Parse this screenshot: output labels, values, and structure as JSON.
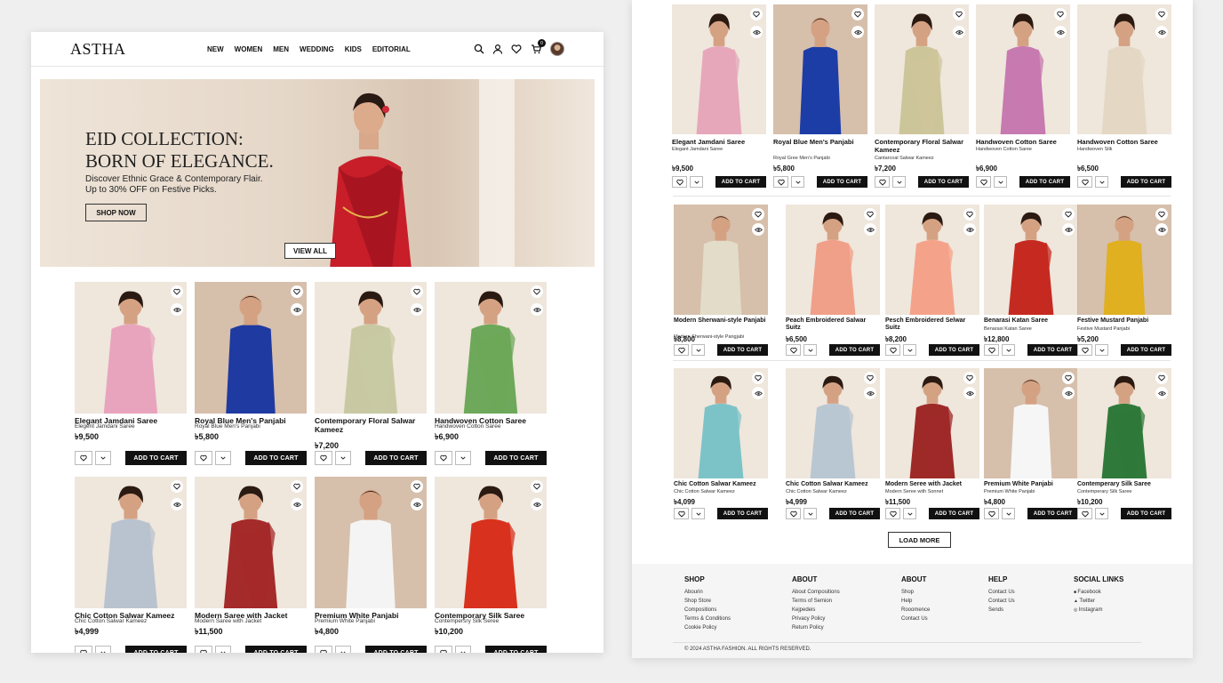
{
  "brand": "ASTHA",
  "nav": [
    "NEW",
    "WOMEN",
    "MEN",
    "WEDDING",
    "KIDS",
    "EDITORIAL"
  ],
  "cart_count": "0",
  "icons": {
    "search": "search-icon",
    "user": "user-icon",
    "wishlist": "heart-icon",
    "cart": "cart-icon",
    "quickview": "eye-icon",
    "dropdown": "chevron-down-icon"
  },
  "hero": {
    "title_line1": "EID COLLECTION:",
    "title_line2": "BORN OF ELEGANCE.",
    "subtitle_line1": "Discover Ethnic Grace & Contemporary Flair.",
    "subtitle_line2": "Up to 30% OFF on Festive Picks.",
    "shop_now": "SHOP NOW",
    "view_all": "VIEW ALL"
  },
  "add_to_cart": "ADD TO CART",
  "left_products": [
    {
      "name": "Elegant Jamdani Saree",
      "sub": "Elegent Jamdani Saree",
      "price": "৳9,500",
      "color": "#e8a4bd"
    },
    {
      "name": "Royal Blue Men's Panjabi",
      "sub": "Royal Blue Men's Panjabi",
      "price": "৳5,800",
      "color": "#1f3aa0"
    },
    {
      "name": "Contemporary Floral Salwar Kameez",
      "sub": "",
      "price": "৳7,200",
      "color": "#c8c9a3"
    },
    {
      "name": "Handwoven Cotton Saree",
      "sub": "Handwoven Cotton Saree",
      "price": "৳6,900",
      "color": "#6ea85a"
    },
    {
      "name": "Chic Cotton Salwar Kameez",
      "sub": "Chic Cotton Salwar Kameez",
      "price": "৳4,999",
      "color": "#b9c3cf"
    },
    {
      "name": "Modern Saree with Jacket",
      "sub": "Modern Saree with Jacket",
      "price": "৳11,500",
      "color": "#a52a2a"
    },
    {
      "name": "Premium White Panjabi",
      "sub": "Premium White Panjabi",
      "price": "৳4,800",
      "color": "#f4f4f4"
    },
    {
      "name": "Contemporary Silk Saree",
      "sub": "Contempersry Silk Seree",
      "price": "৳10,200",
      "color": "#d8321e"
    }
  ],
  "right_row1": [
    {
      "name": "Elegant Jamdani Saree",
      "sub": "Elegant Jamdani Saree",
      "price": "৳9,500",
      "color": "#e6a7bb"
    },
    {
      "name": "Royal Blue Men's Panjabi",
      "sub": "Royal Gree Men's Panjabi",
      "price": "৳5,800",
      "color": "#1d3da6"
    },
    {
      "name": "Contemporary Floral Salwar Kameez",
      "sub": "Cantarcoal Salwar Kameez",
      "price": "৳7,200",
      "color": "#cdc59a"
    },
    {
      "name": "Handwoven Cotton Saree",
      "sub": "Handwoven Cotton Saree",
      "price": "৳6,900",
      "color": "#c77ab0"
    },
    {
      "name": "Handwoven Cotton Saree",
      "sub": "Handwoven Silk",
      "price": "৳6,500",
      "color": "#e4d8c4"
    }
  ],
  "right_row2": [
    {
      "name": "Modern Sherwani-style Panjabi",
      "sub": "Modern Sherwani-style Pangjabi",
      "price": "৳8,800",
      "color": "#e3dcc8"
    },
    {
      "name": "Peach Embroidered Salwar Suitz",
      "sub": "",
      "price": "৳6,500",
      "color": "#f0a088"
    },
    {
      "name": "Pesch Embroidered Selwar Suitz",
      "sub": "",
      "price": "৳8,200",
      "color": "#f4a38a"
    },
    {
      "name": "Benarasi Katan Saree",
      "sub": "Benarasi Katan Saree",
      "price": "৳12,800",
      "color": "#c52a20"
    },
    {
      "name": "Festive Mustard Panjabi",
      "sub": "Festive Mustard Panjabi",
      "price": "৳5,200",
      "color": "#e0b020"
    }
  ],
  "right_row3": [
    {
      "name": "Chic Cotton Salwar Kameez",
      "sub": "Chic Cotton Salwar Kameez",
      "price": "৳4,099",
      "color": "#7cc3c8"
    },
    {
      "name": "Chic Cotton Salwar Kameez",
      "sub": "Chic Cotton Salwar Kameez",
      "price": "৳4,999",
      "color": "#b9c7d2"
    },
    {
      "name": "Modern Seree with Jacket",
      "sub": "Modern Seree with Sonnet",
      "price": "৳11,500",
      "color": "#9e2a28"
    },
    {
      "name": "Premium White Panjabi",
      "sub": "Premium White Panjabi",
      "price": "৳4,800",
      "color": "#f6f6f6"
    },
    {
      "name": "Contemperary Silk Saree",
      "sub": "Contemperary Silk Saree",
      "price": "৳10,200",
      "color": "#2f7a3a"
    }
  ],
  "load_more": "LOAD MORE",
  "footer": {
    "shop": {
      "title": "SHOP",
      "items": [
        "Abourin",
        "Shop Store",
        "Compositions",
        "Terms & Conditions",
        "Cookie Policy"
      ]
    },
    "about1": {
      "title": "ABOUT",
      "items": [
        "About Compositions",
        "Terms of Semion",
        "Kejpedeis",
        "Privacy Policy",
        "Return Policy"
      ]
    },
    "about2": {
      "title": "ABOUT",
      "items": [
        "Shop",
        "Help",
        "Rooomence",
        "Contact Us"
      ]
    },
    "help": {
      "title": "HELP",
      "items": [
        "Contact Us",
        "Contact Us",
        "Sends"
      ]
    },
    "social": {
      "title": "SOCIAL LINKS",
      "items": [
        "Facebook",
        "Twitter",
        "Instagram"
      ]
    },
    "copyright": "© 2024 ASTHA FASHION. ALL RIGHTS RESERVED."
  }
}
